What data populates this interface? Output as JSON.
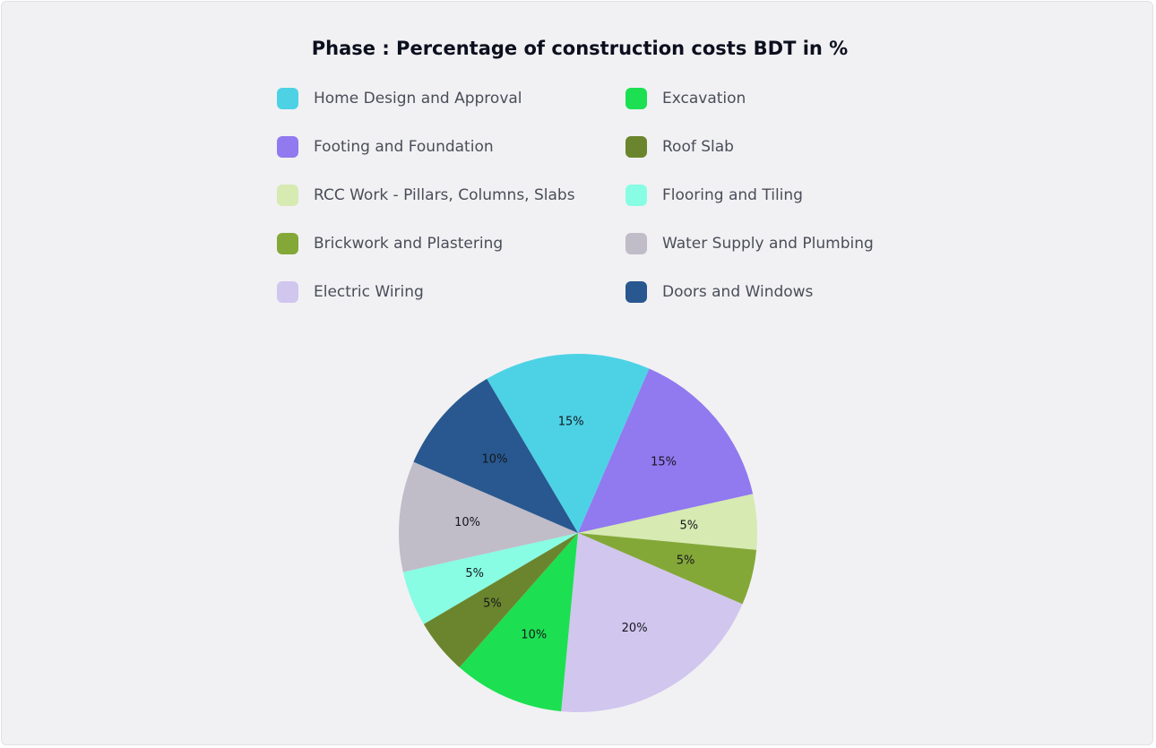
{
  "chart_data": {
    "type": "pie",
    "title": "Phase : Percentage of construction costs BDT in %",
    "slices": [
      {
        "label": "Home Design and Approval",
        "value": 15,
        "display": "15%",
        "color": "#4dd2e5"
      },
      {
        "label": "Excavation",
        "value": 10,
        "display": "10%",
        "color": "#1ce052"
      },
      {
        "label": "Footing and Foundation",
        "value": 15,
        "display": "15%",
        "color": "#9179ef"
      },
      {
        "label": "Roof Slab",
        "value": 5,
        "display": "5%",
        "color": "#6b852e"
      },
      {
        "label": "RCC Work - Pillars, Columns, Slabs",
        "value": 5,
        "display": "5%",
        "color": "#d6eab2"
      },
      {
        "label": "Flooring and Tiling",
        "value": 5,
        "display": "5%",
        "color": "#88fde3"
      },
      {
        "label": "Brickwork and Plastering",
        "value": 5,
        "display": "5%",
        "color": "#84a838"
      },
      {
        "label": "Water Supply and Plumbing",
        "value": 10,
        "display": "10%",
        "color": "#c0bcc8"
      },
      {
        "label": "Electric Wiring",
        "value": 20,
        "display": "20%",
        "color": "#d1c6ee"
      },
      {
        "label": "Doors and Windows",
        "value": 10,
        "display": "10%",
        "color": "#28588f"
      }
    ],
    "slice_order_clockwise_from_top": [
      "Home Design and Approval",
      "Footing and Foundation",
      "RCC Work - Pillars, Columns, Slabs",
      "Brickwork and Plastering",
      "Electric Wiring",
      "Excavation",
      "Roof Slab",
      "Flooring and Tiling",
      "Water Supply and Plumbing",
      "Doors and Windows"
    ],
    "legend_position": "top"
  }
}
